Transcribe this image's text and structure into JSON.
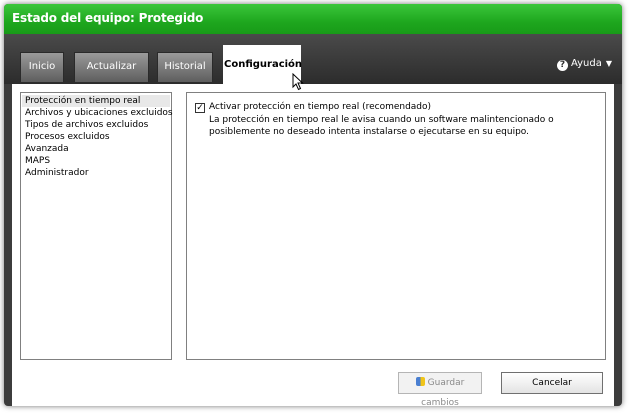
{
  "window": {
    "title": "Estado del equipo: Protegido"
  },
  "tabs": [
    {
      "label": "Inicio",
      "active": false
    },
    {
      "label": "Actualizar",
      "active": false
    },
    {
      "label": "Historial",
      "active": false
    },
    {
      "label": "Configuración",
      "active": true
    }
  ],
  "help": {
    "label": "Ayuda",
    "icon": "question-icon"
  },
  "sidebar": {
    "items": [
      {
        "label": "Protección en tiempo real",
        "selected": true
      },
      {
        "label": "Archivos y ubicaciones excluidos",
        "selected": false
      },
      {
        "label": "Tipos de archivos excluidos",
        "selected": false
      },
      {
        "label": "Procesos excluidos",
        "selected": false
      },
      {
        "label": "Avanzada",
        "selected": false
      },
      {
        "label": "MAPS",
        "selected": false
      },
      {
        "label": "Administrador",
        "selected": false
      }
    ]
  },
  "panel": {
    "checkbox_label": "Activar protección en tiempo real (recomendado)",
    "checkbox_checked": true,
    "description_line1": "La protección en tiempo real le avisa cuando un software malintencionado o",
    "description_line2": "posiblemente no deseado intenta instalarse o ejecutarse en su equipo."
  },
  "buttons": {
    "save_label": "Guardar cambios",
    "save_enabled": false,
    "cancel_label": "Cancelar"
  },
  "colors": {
    "title_bar": "#2bb52b",
    "header": "#3a3a3a"
  }
}
